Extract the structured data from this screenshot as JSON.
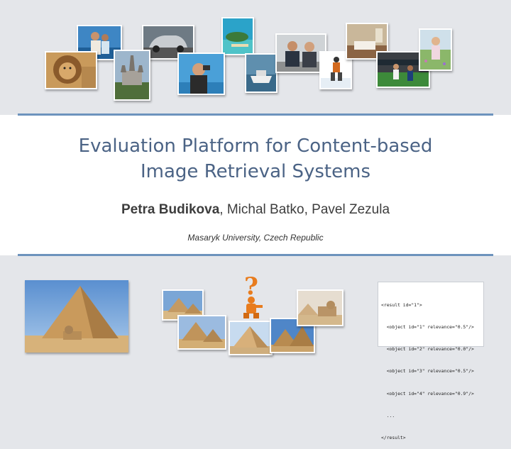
{
  "slide": {
    "title_line1": "Evaluation Platform for Content-based",
    "title_line2": "Image Retrieval Systems",
    "authors": {
      "first_author": "Petra Budikova",
      "other_authors": ", Michal Batko, Pavel Zezula"
    },
    "affiliation": "Masaryk University, Czech Republic"
  },
  "top_photos": [
    {
      "name": "photo-people-at-sea"
    },
    {
      "name": "photo-car"
    },
    {
      "name": "photo-beach-island"
    },
    {
      "name": "photo-lion"
    },
    {
      "name": "photo-castle"
    },
    {
      "name": "photo-woman-camera"
    },
    {
      "name": "photo-boat"
    },
    {
      "name": "photo-business-men"
    },
    {
      "name": "photo-skier"
    },
    {
      "name": "photo-hotel-room"
    },
    {
      "name": "photo-soccer"
    },
    {
      "name": "photo-girl-flowers"
    }
  ],
  "query_icon": {
    "symbol": "?",
    "color": "#e87c1e"
  },
  "xml_result": {
    "lines": [
      "<result id=\"1\">",
      "  <object id=\"1\" relevance=\"0.5\"/>",
      "  <object id=\"2\" relevance=\"0.0\"/>",
      "  <object id=\"3\" relevance=\"0.5\"/>",
      "  <object id=\"4\" relevance=\"0.9\"/>",
      "  ...",
      "</result>"
    ]
  },
  "colors": {
    "title": "#4b6385",
    "rule": "#6d93bd",
    "background": "#e4e6ea"
  }
}
